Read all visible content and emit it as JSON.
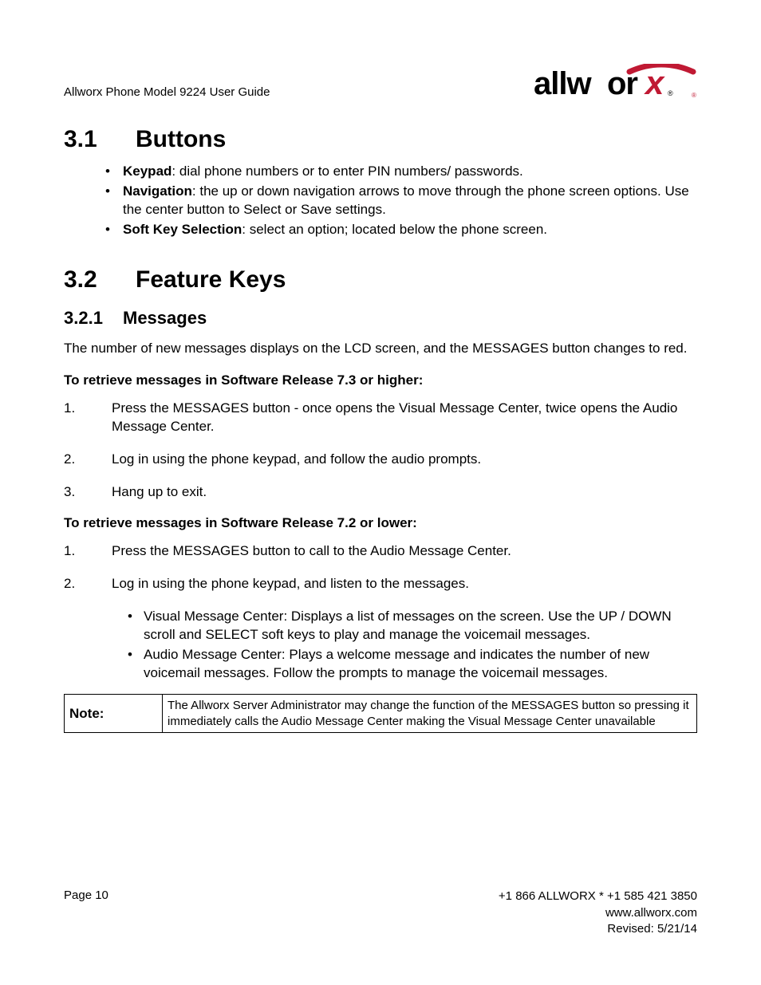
{
  "header": {
    "title": "Allworx Phone Model 9224 User Guide",
    "logo_name": "allworx"
  },
  "sections": {
    "s31": {
      "num": "3.1",
      "title": "Buttons"
    },
    "s32": {
      "num": "3.2",
      "title": "Feature Keys"
    },
    "s321": {
      "num": "3.2.1",
      "title": "Messages"
    }
  },
  "buttons_list": {
    "keypad_label": "Keypad",
    "keypad_text": ": dial phone numbers or to enter PIN numbers/ passwords.",
    "nav_label": "Navigation",
    "nav_text": ": the up or down navigation arrows to move through the phone screen options. Use the center button to Select or Save settings.",
    "softkey_label": "Soft Key Selection",
    "softkey_text": ": select an option; located below the phone screen."
  },
  "messages": {
    "intro": "The number of new messages displays on the LCD screen, and the MESSAGES button changes to red.",
    "retrieve73": "To retrieve messages in Software Release 7.3 or higher:",
    "steps73": {
      "s1n": "1.",
      "s1": "Press the MESSAGES button - once opens the Visual Message Center, twice opens the Audio Message Center.",
      "s2n": "2.",
      "s2": "Log in using the phone keypad, and follow the audio prompts.",
      "s3n": "3.",
      "s3": "Hang up to exit."
    },
    "retrieve72": "To retrieve messages in Software Release 7.2 or lower:",
    "steps72": {
      "s1n": "1.",
      "s1": "Press the MESSAGES button to call to the Audio Message Center.",
      "s2n": "2.",
      "s2": "Log in using the phone keypad, and listen to the messages."
    },
    "centers": {
      "visual": "Visual Message Center: Displays a list of messages on the screen. Use the UP / DOWN scroll and SELECT soft keys to play and manage the voicemail messages.",
      "audio": "Audio Message Center: Plays a welcome message and indicates the number of new voicemail messages. Follow the prompts to manage the voicemail messages."
    }
  },
  "note": {
    "label": "Note:",
    "text": "The Allworx Server Administrator may change the function of the MESSAGES button so pressing it immediately calls the Audio Message Center making the Visual Message Center unavailable"
  },
  "footer": {
    "page": "Page 10",
    "phone": "+1 866 ALLWORX * +1 585 421 3850",
    "url": "www.allworx.com",
    "revised": "Revised: 5/21/14"
  }
}
